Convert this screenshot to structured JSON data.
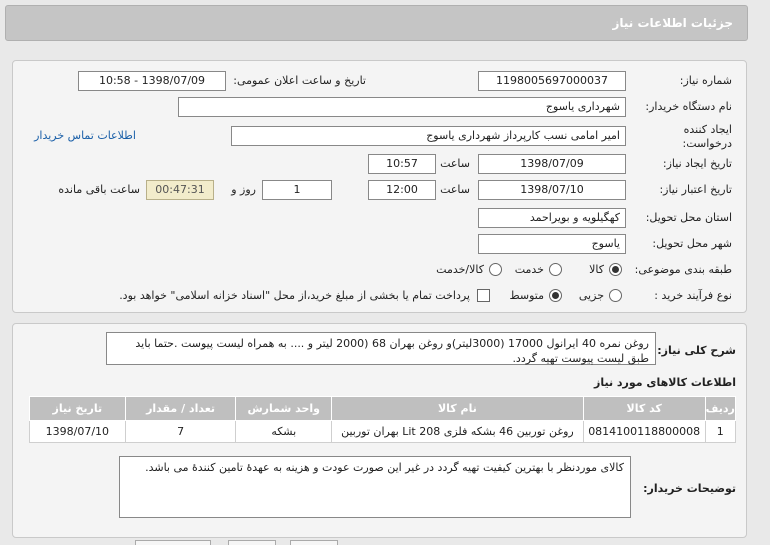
{
  "header": {
    "title": "جزئیات اطلاعات نیاز"
  },
  "form": {
    "need_number_label": "شماره نیاز:",
    "need_number": "1198005697000037",
    "announce_label": "تاریخ و ساعت اعلان عمومی:",
    "announce_value": "1398/07/09 - 10:58",
    "buyer_org_label": "نام دستگاه خریدار:",
    "buyer_org": "شهرداری یاسوج",
    "creator_label": "ایجاد کننده درخواست:",
    "creator": "امیر امامی نسب کارپرداز شهرداری یاسوج",
    "contact_link": "اطلاعات تماس خریدار",
    "create_date_label": "تاریخ ایجاد نیاز:",
    "create_date": "1398/07/09",
    "time_label": "ساعت",
    "create_time": "10:57",
    "valid_date_label": "تاریخ اعتبار نیاز:",
    "valid_date": "1398/07/10",
    "valid_time": "12:00",
    "days": "1",
    "days_label": "روز و",
    "remaining": "00:47:31",
    "remaining_label": "ساعت باقی مانده",
    "province_label": "استان محل تحویل:",
    "province": "کهگیلویه و بویراحمد",
    "city_label": "شهر محل تحویل:",
    "city": "یاسوج",
    "category_label": "طبقه بندی موضوعی:",
    "category_options": [
      "کالا",
      "خدمت",
      "کالا/خدمت"
    ],
    "process_label": "نوع فرآیند خرید :",
    "process_options": [
      "جزیی",
      "متوسط"
    ],
    "payment_note": "پرداخت تمام یا بخشی از مبلغ خرید،از محل \"اسناد خزانه اسلامی\" خواهد بود."
  },
  "description": {
    "label": "شرح کلی نیاز:",
    "text": "روغن نمره 40 ایرانول 17000 (3000لیتر)و روغن بهران 68 (2000 لیتر و .... به همراه لیست پیوست .حتما باید طبق لیست پیوست تهیه گردد."
  },
  "goods": {
    "title": "اطلاعات کالاهای مورد نیاز",
    "columns": [
      "ردیف",
      "کد کالا",
      "نام کالا",
      "واحد شمارش",
      "تعداد / مقدار",
      "تاریخ نیاز"
    ],
    "rows": [
      [
        "1",
        "0814100118800008",
        "روغن توربین 46 بشکه فلزی 208 Lit بهران توربین",
        "بشکه",
        "7",
        "1398/07/10"
      ]
    ]
  },
  "notes": {
    "label": "توضیحات خریدار:",
    "text": "کالای موردنظر با بهترین کیفیت تهیه گردد در غیر این صورت عودت و هزینه به عهدۀ تامین کنندۀ می باشد."
  }
}
